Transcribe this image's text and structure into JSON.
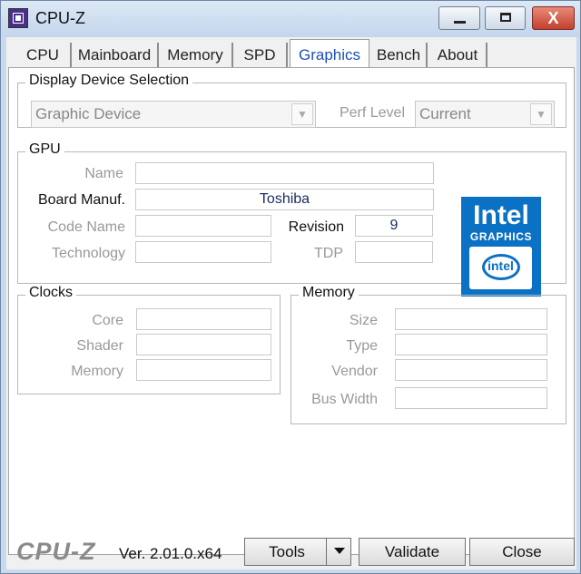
{
  "window": {
    "title": "CPU-Z",
    "buttons": {
      "minimize": "",
      "maximize": "",
      "close": "X"
    }
  },
  "tabs": [
    {
      "label": "CPU"
    },
    {
      "label": "Mainboard"
    },
    {
      "label": "Memory"
    },
    {
      "label": "SPD"
    },
    {
      "label": "Graphics",
      "active": true
    },
    {
      "label": "Bench"
    },
    {
      "label": "About"
    }
  ],
  "display_device": {
    "group_title": "Display Device Selection",
    "device": "Graphic Device",
    "perf_label": "Perf Level",
    "perf_value": "Current"
  },
  "gpu": {
    "group_title": "GPU",
    "name_label": "Name",
    "name_value": "",
    "board_manuf_label": "Board Manuf.",
    "board_manuf_value": "Toshiba",
    "code_name_label": "Code Name",
    "code_name_value": "",
    "revision_label": "Revision",
    "revision_value": "9",
    "technology_label": "Technology",
    "technology_value": "",
    "tdp_label": "TDP",
    "tdp_value": ""
  },
  "logo": {
    "brand": "Intel",
    "subtitle": "GRAPHICS",
    "badge": "intel"
  },
  "clocks": {
    "group_title": "Clocks",
    "core_label": "Core",
    "shader_label": "Shader",
    "memory_label": "Memory"
  },
  "memory": {
    "group_title": "Memory",
    "size_label": "Size",
    "type_label": "Type",
    "vendor_label": "Vendor",
    "bus_width_label": "Bus Width"
  },
  "footer": {
    "logo": "CPU-Z",
    "version": "Ver. 2.01.0.x64",
    "tools_label": "Tools",
    "validate_label": "Validate",
    "close_label": "Close"
  }
}
